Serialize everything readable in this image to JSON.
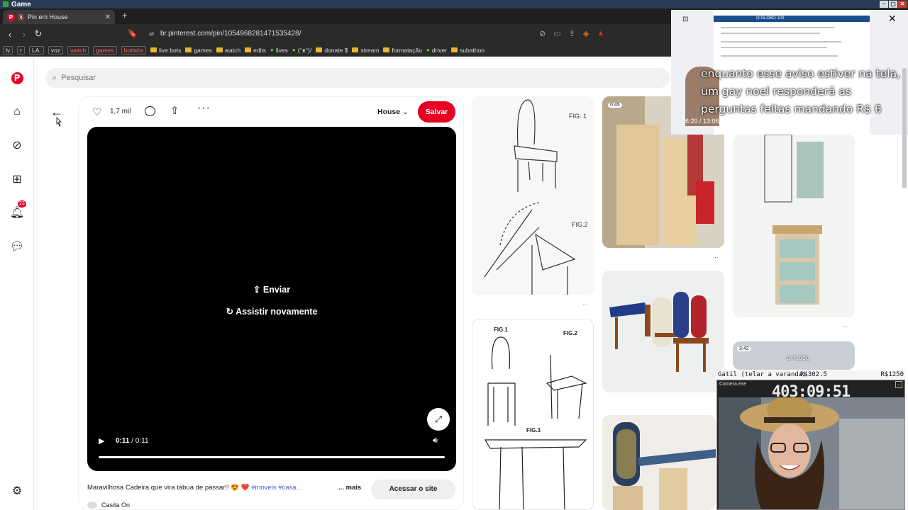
{
  "window": {
    "title": "Game",
    "controls": [
      "–",
      "▢",
      "✕"
    ]
  },
  "browser": {
    "tab_title": "Pin em House",
    "new_tab_symbol": "+",
    "url": "br.pinterest.com/pin/1054968281471535428/"
  },
  "bookmarks": [
    {
      "label": "lv",
      "type": "box"
    },
    {
      "label": "r",
      "type": "box"
    },
    {
      "label": "LA.",
      "type": "box"
    },
    {
      "label": "voz",
      "type": "box"
    },
    {
      "label": "watch",
      "type": "box-red"
    },
    {
      "label": "games",
      "type": "box-red"
    },
    {
      "label": "botlabs",
      "type": "box-red"
    },
    {
      "label": "live bots",
      "type": "folder"
    },
    {
      "label": "games",
      "type": "folder"
    },
    {
      "label": "watch",
      "type": "folder"
    },
    {
      "label": "edits",
      "type": "folder"
    },
    {
      "label": "lives",
      "type": "icon"
    },
    {
      "label": "(ᵔᴥᵔ)/",
      "type": "icon"
    },
    {
      "label": "donate $",
      "type": "folder"
    },
    {
      "label": "stream",
      "type": "folder"
    },
    {
      "label": "formatação",
      "type": "folder"
    },
    {
      "label": "driver",
      "type": "icon"
    },
    {
      "label": "subathon",
      "type": "folder"
    }
  ],
  "search": {
    "placeholder": "Pesquisar"
  },
  "sidebar": {
    "notification_count": "23"
  },
  "pin": {
    "likes": "1,7 mil",
    "board": "House",
    "save_label": "Salvar",
    "send_label": "Enviar",
    "replay_label": "Assistir novamente",
    "time_current": "0:11",
    "time_total": "/ 0:11",
    "progress": 1.0,
    "description": "Maravilhosa Cadeira que vira tábua de passar!! 😍 ❤️",
    "description_tags": "#moveis #casa...",
    "more_label": "... mais",
    "visit_label": "Acessar o site",
    "author": "Casita On"
  },
  "grid": {
    "fig1": "FIG. 1",
    "fig2": "FIG.2",
    "video_badge": "0:45",
    "drawing2_fig1": "FIG.1",
    "drawing2_fig2": "FIG.2",
    "drawing2_fig3": "FIG.3",
    "video2_badge": "3:42",
    "video2_caption": "ai fudeu",
    "more_dots": "..."
  },
  "overlay_video": {
    "caption": "enquanto esse aviso estiver na tela, um gay noel responderá as perguntas feitas mandando R$ 6",
    "time": "6:20 / 13:06",
    "site": "O GLOBO 100"
  },
  "obs": {
    "bar_left": "Gatil (telar a varanda)",
    "bar_mid": "R$302.5",
    "bar_right": "R$1250",
    "panel_title": "Camera.exe",
    "timer": "403:09:51"
  }
}
